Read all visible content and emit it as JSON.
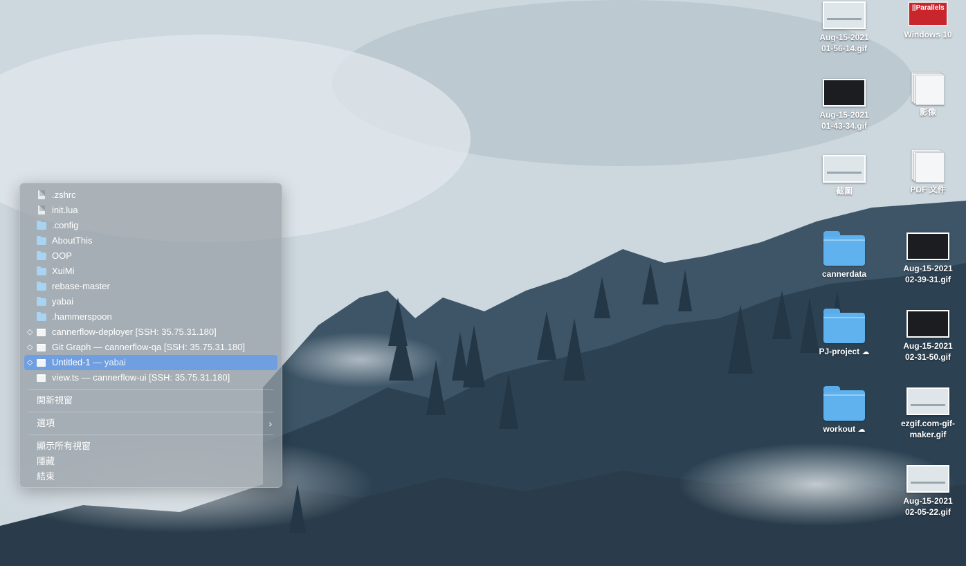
{
  "dock_menu": {
    "items": [
      {
        "type": "file",
        "label": ".zshrc",
        "sub": "",
        "marker": "",
        "selected": false
      },
      {
        "type": "file",
        "label": "init.lua",
        "sub": "",
        "marker": "",
        "selected": false
      },
      {
        "type": "folder",
        "label": ".config",
        "sub": "",
        "marker": "",
        "selected": false
      },
      {
        "type": "folder",
        "label": "AboutThis",
        "sub": "",
        "marker": "",
        "selected": false
      },
      {
        "type": "folder",
        "label": "OOP",
        "sub": "",
        "marker": "",
        "selected": false
      },
      {
        "type": "folder",
        "label": "XuiMi",
        "sub": "",
        "marker": "",
        "selected": false
      },
      {
        "type": "folder",
        "label": "rebase-master",
        "sub": "",
        "marker": "",
        "selected": false
      },
      {
        "type": "folder",
        "label": "yabai",
        "sub": "",
        "marker": "",
        "selected": false
      },
      {
        "type": "folder",
        "label": ".hammerspoon",
        "sub": "",
        "marker": "",
        "selected": false
      },
      {
        "type": "window",
        "label": "cannerflow-deployer [SSH: 35.75.31.180]",
        "sub": "",
        "marker": "◇",
        "selected": false
      },
      {
        "type": "window",
        "label": "Git Graph — cannerflow-qa [SSH: 35.75.31.180]",
        "sub": "",
        "marker": "◇",
        "selected": false
      },
      {
        "type": "window",
        "label": "Untitled-1",
        "sub": " — yabai",
        "marker": "◇",
        "selected": true
      },
      {
        "type": "window",
        "label": "view.ts — cannerflow-ui [SSH: 35.75.31.180]",
        "sub": "",
        "marker": "",
        "selected": false
      }
    ],
    "new_window": "開新視窗",
    "options": "選項",
    "options_chevron": "›",
    "show_all_windows": "顯示所有視窗",
    "hide": "隱藏",
    "quit": "結束",
    "selected_color": "#6f9fe0"
  },
  "desktop": {
    "icons": [
      {
        "name": "Aug-15-2021\n01-56-14.gif",
        "line1": "Aug-15-2021",
        "line2": "01-56-14.gif",
        "kind": "gif"
      },
      {
        "name": "Windows 10",
        "line1": "Windows 10",
        "line2": "",
        "kind": "parallels"
      },
      {
        "line1": "Aug-15-2021",
        "line2": "01-43-34.gif",
        "kind": "gif-dark"
      },
      {
        "line1": "影像",
        "line2": "",
        "kind": "stack"
      },
      {
        "line1": "截圖",
        "line2": "",
        "kind": "screenshot"
      },
      {
        "line1": "PDF 文件",
        "line2": "",
        "kind": "stack"
      },
      {
        "line1": "cannerdata",
        "line2": "",
        "kind": "folder"
      },
      {
        "line1": "Aug-15-2021",
        "line2": "02-39-31.gif",
        "kind": "gif-dark"
      },
      {
        "line1": "PJ-project",
        "line2": "",
        "kind": "folder",
        "cloud": "☁"
      },
      {
        "line1": "Aug-15-2021",
        "line2": "02-31-50.gif",
        "kind": "gif-dark"
      },
      {
        "line1": "workout",
        "line2": "",
        "kind": "folder",
        "cloud": "☁"
      },
      {
        "line1": "ezgif.com-gif-",
        "line2": "maker.gif",
        "kind": "gif"
      },
      {
        "line1": "Aug-15-2021",
        "line2": "02-05-22.gif",
        "kind": "gif"
      }
    ],
    "parallels_brand": "||Parallels"
  }
}
